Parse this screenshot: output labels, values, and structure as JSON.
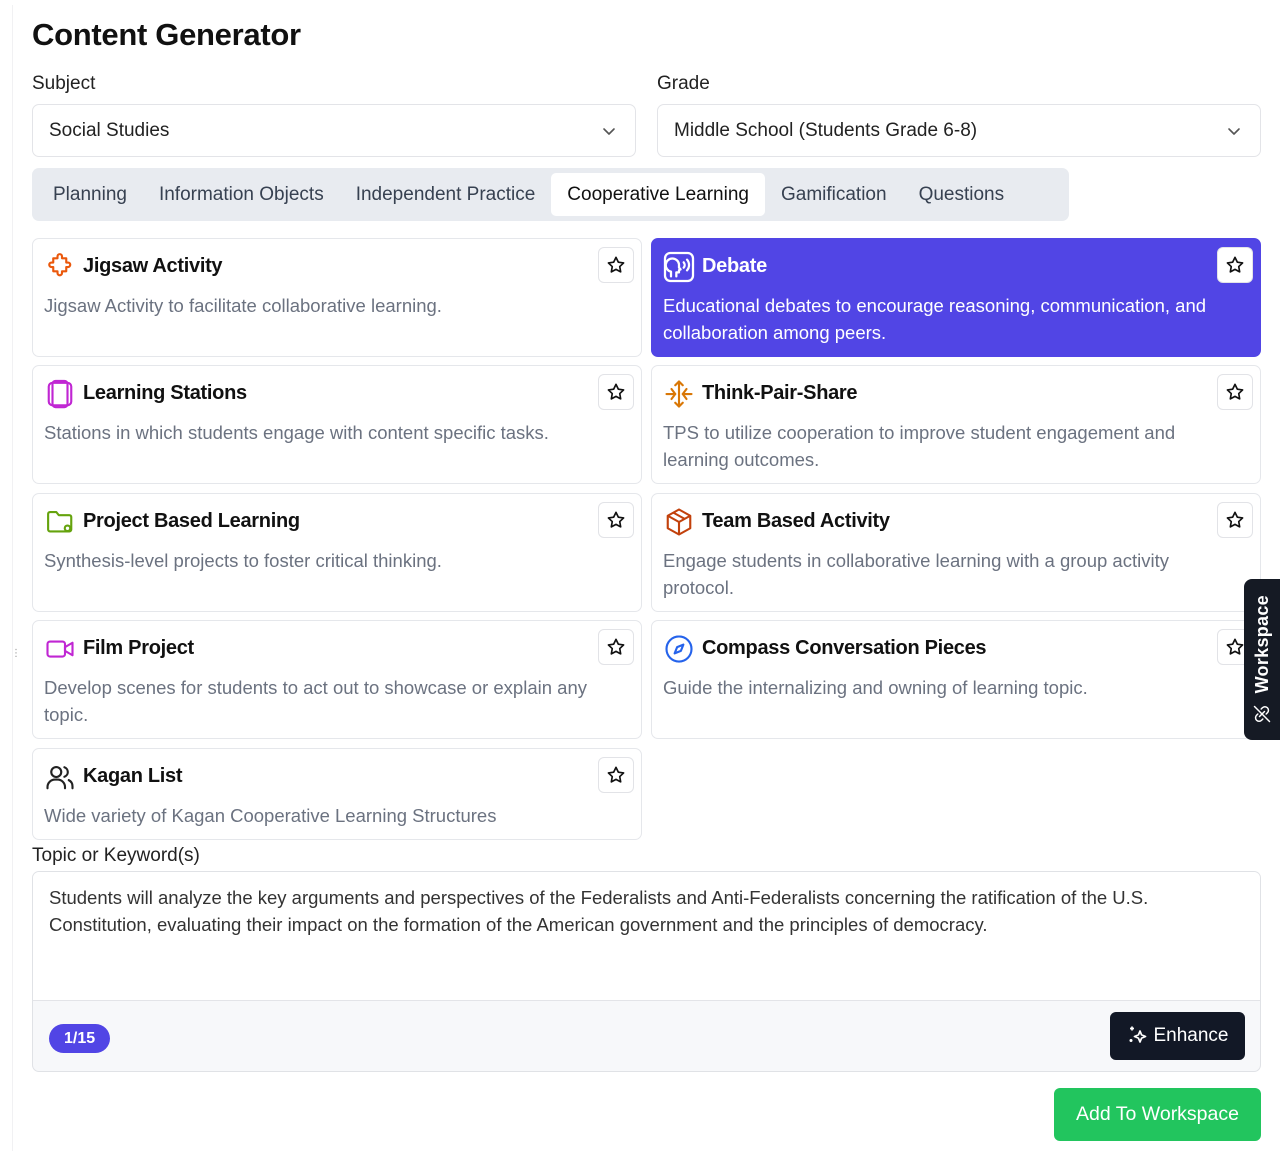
{
  "page": {
    "title": "Content Generator"
  },
  "subject": {
    "label": "Subject",
    "value": "Social Studies"
  },
  "grade": {
    "label": "Grade",
    "value": "Middle School (Students Grade 6-8)"
  },
  "tabs": [
    {
      "label": "Planning"
    },
    {
      "label": "Information Objects"
    },
    {
      "label": "Independent Practice"
    },
    {
      "label": "Cooperative Learning",
      "active": true
    },
    {
      "label": "Gamification"
    },
    {
      "label": "Questions"
    }
  ],
  "cards": [
    {
      "title": "Jigsaw Activity",
      "desc": "Jigsaw Activity to facilitate collaborative learning.",
      "icon": "puzzle-icon"
    },
    {
      "title": "Debate",
      "desc": "Educational debates to encourage reasoning, communication, and collaboration among peers.",
      "icon": "speaking-head-icon",
      "selected": true
    },
    {
      "title": "Learning Stations",
      "desc": "Stations in which students engage with content specific tasks.",
      "icon": "stations-icon"
    },
    {
      "title": "Think-Pair-Share",
      "desc": "TPS to utilize cooperation to improve student engagement and learning outcomes.",
      "icon": "arrows-exchange-icon"
    },
    {
      "title": "Project Based Learning",
      "desc": "Synthesis-level projects to foster critical thinking.",
      "icon": "folder-icon"
    },
    {
      "title": "Team Based Activity",
      "desc": "Engage students in collaborative learning with a group activity protocol.",
      "icon": "package-icon"
    },
    {
      "title": "Film Project",
      "desc": "Develop scenes for students to act out to showcase or explain any topic.",
      "icon": "video-icon"
    },
    {
      "title": "Compass Conversation Pieces",
      "desc": "Guide the internalizing and owning of learning topic.",
      "icon": "compass-icon"
    },
    {
      "title": "Kagan List",
      "desc": "Wide variety of Kagan Cooperative Learning Structures",
      "icon": "users-icon"
    }
  ],
  "topic": {
    "label": "Topic or Keyword(s)",
    "value": "Students will analyze the key arguments and perspectives of the Federalists and Anti-Federalists concerning the ratification of the U.S. Constitution, evaluating their impact on the formation of the American government and the principles of democracy.",
    "counter": "1/15",
    "enhance_label": "Enhance"
  },
  "actions": {
    "add_label": "Add To Workspace"
  },
  "workspace": {
    "label": "Workspace"
  },
  "colors": {
    "accent": "#5145e5",
    "success": "#22c55e",
    "dark": "#121826"
  }
}
